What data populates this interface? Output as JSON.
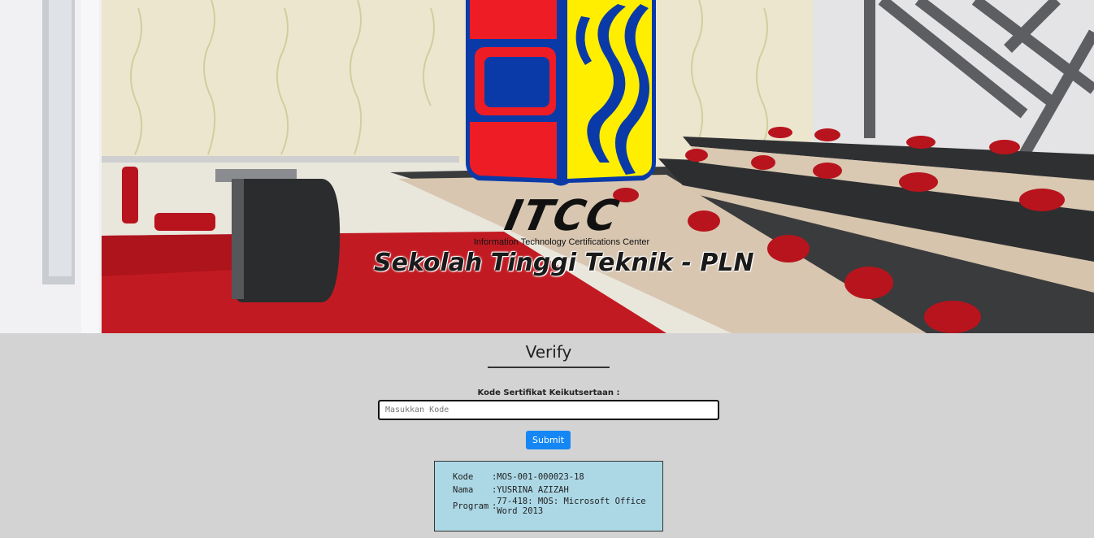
{
  "hero": {
    "logo_text": "ITCC",
    "logo_subtitle": "Information Technology Certifications Center",
    "school_name": "Sekolah Tinggi Teknik - PLN"
  },
  "verify": {
    "title": "Verify",
    "code_label": "Kode Sertifikat Keikutsertaan :",
    "code_input_value": "",
    "code_input_placeholder": "Masukkan Kode",
    "submit_label": "Submit"
  },
  "result": {
    "rows": [
      {
        "key": "Kode",
        "sep": ":",
        "value": "MOS-001-000023-18"
      },
      {
        "key": "Nama",
        "sep": ":",
        "value": "YUSRINA AZIZAH"
      },
      {
        "key": "Program",
        "sep": ":",
        "value": "77-418: MOS: Microsoft Office Word 2013"
      }
    ]
  },
  "colors": {
    "page_bg": "#d3d3d3",
    "submit_bg": "#1587f5",
    "result_bg": "#acd8e6",
    "logo_red": "#ee1c24",
    "logo_blue": "#0a3aa8",
    "logo_yellow": "#ffee00"
  }
}
